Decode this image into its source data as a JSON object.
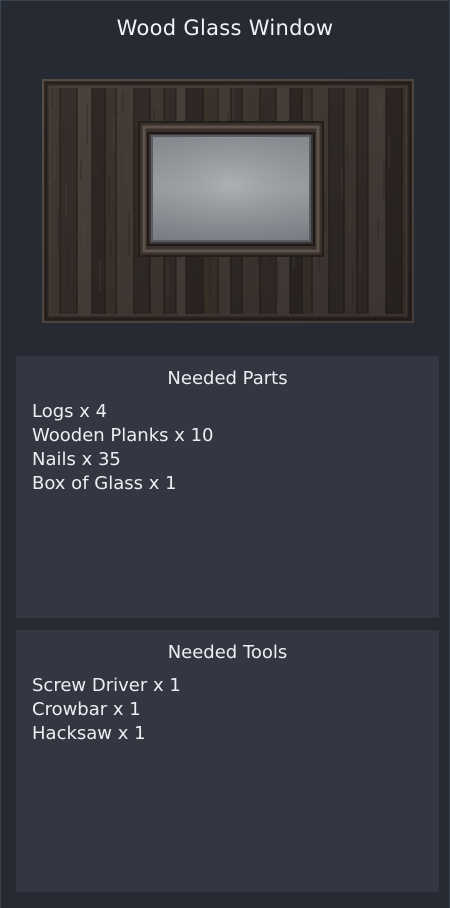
{
  "window_title": "Wood Glass Window",
  "preview_icon": "wood-glass-window-icon",
  "parts_panel": {
    "title": "Needed Parts",
    "items": [
      "Logs x 4",
      "Wooden Planks x 10",
      "Nails x 35",
      "Box of Glass x 1"
    ]
  },
  "tools_panel": {
    "title": "Needed Tools",
    "items": [
      "Screw Driver x 1",
      "Crowbar x 1",
      "Hacksaw x 1"
    ]
  },
  "colors": {
    "background": "#252a33",
    "panel": "#323742",
    "text": "#eceef2"
  }
}
